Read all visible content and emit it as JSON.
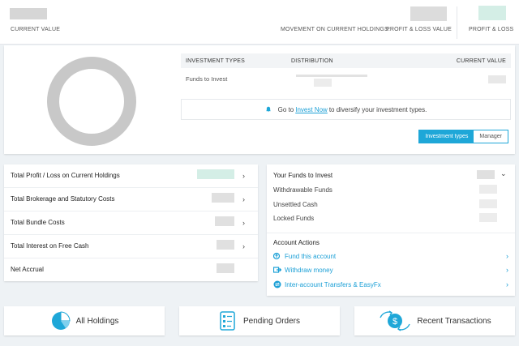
{
  "topbar": {
    "current_value_label": "CURRENT VALUE",
    "movement_label": "MOVEMENT ON CURRENT HOLDINGS:",
    "pl_value_label": "PROFIT & LOSS VALUE",
    "pl_label": "PROFIT & LOSS"
  },
  "portfolio": {
    "columns": [
      "INVESTMENT TYPES",
      "DISTRIBUTION",
      "CURRENT VALUE"
    ],
    "rows": [
      {
        "type": "Funds to Invest"
      }
    ],
    "info_prefix": "Go to",
    "info_link": "Invest Now",
    "info_suffix": "to diversify your investment types.",
    "toggle_active": "Investment types",
    "toggle_inactive": "Manager"
  },
  "summary": {
    "rows": [
      {
        "label": "Total Profit / Loss on Current Holdings"
      },
      {
        "label": "Total Brokerage and Statutory Costs"
      },
      {
        "label": "Total Bundle Costs"
      },
      {
        "label": "Total Interest on Free Cash"
      },
      {
        "label": "Net Accrual"
      }
    ]
  },
  "funds": {
    "title": "Your Funds to Invest",
    "rows": [
      "Withdrawable Funds",
      "Unsettled Cash",
      "Locked Funds"
    ],
    "actions_title": "Account Actions",
    "actions": [
      "Fund this account",
      "Withdraw money",
      "Inter-account Transfers & EasyFx"
    ]
  },
  "tiles": {
    "holdings": "All Holdings",
    "pending": "Pending Orders",
    "transactions": "Recent Transactions"
  },
  "colors": {
    "accent": "#1ea7d8",
    "donut": "#c8c8c8",
    "background": "#eef2f5"
  }
}
